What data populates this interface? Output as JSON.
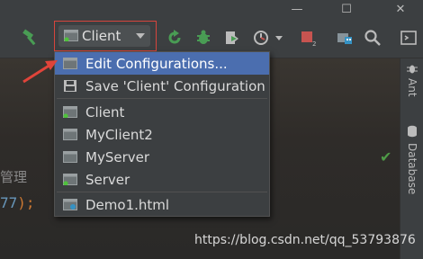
{
  "window": {
    "minimize_glyph": "—",
    "maximize_glyph": "☐",
    "close_glyph": "✕"
  },
  "toolbar": {
    "run_config": {
      "label": "Client",
      "icon": "run-config-icon"
    },
    "icons": [
      "hammer-icon",
      "rerun-icon",
      "debug-icon",
      "coverage-icon",
      "profile-icon",
      "stop-icon",
      "project-structure-icon",
      "search-icon",
      "terminal-icon"
    ]
  },
  "dropdown": {
    "items": [
      {
        "label": "Edit Configurations...",
        "icon": "edit-config-icon",
        "selected": true
      },
      {
        "label": "Save 'Client' Configuration",
        "icon": "save-icon",
        "selected": false
      },
      {
        "label": "Client",
        "icon": "app-config-running-icon",
        "selected": false
      },
      {
        "label": "MyClient2",
        "icon": "app-config-icon",
        "selected": false
      },
      {
        "label": "MyServer",
        "icon": "app-config-icon",
        "selected": false
      },
      {
        "label": "Server",
        "icon": "app-config-running-icon",
        "selected": false
      },
      {
        "label": "Demo1.html",
        "icon": "html-config-icon",
        "selected": false
      }
    ]
  },
  "editor": {
    "line1_text": "管理",
    "line2_number": "77",
    "line2_punct": ");"
  },
  "sidebar": {
    "tabs": [
      {
        "label": "Ant",
        "icon": "ant-icon"
      },
      {
        "label": "Database",
        "icon": "database-icon"
      }
    ]
  },
  "watermark": "https://blog.csdn.net/qq_53793876",
  "colors": {
    "selection": "#4b6eaf",
    "highlight_border": "#d6453d",
    "arrow": "#e0443a",
    "run_green": "#499c54",
    "stop_red": "#c75450"
  }
}
